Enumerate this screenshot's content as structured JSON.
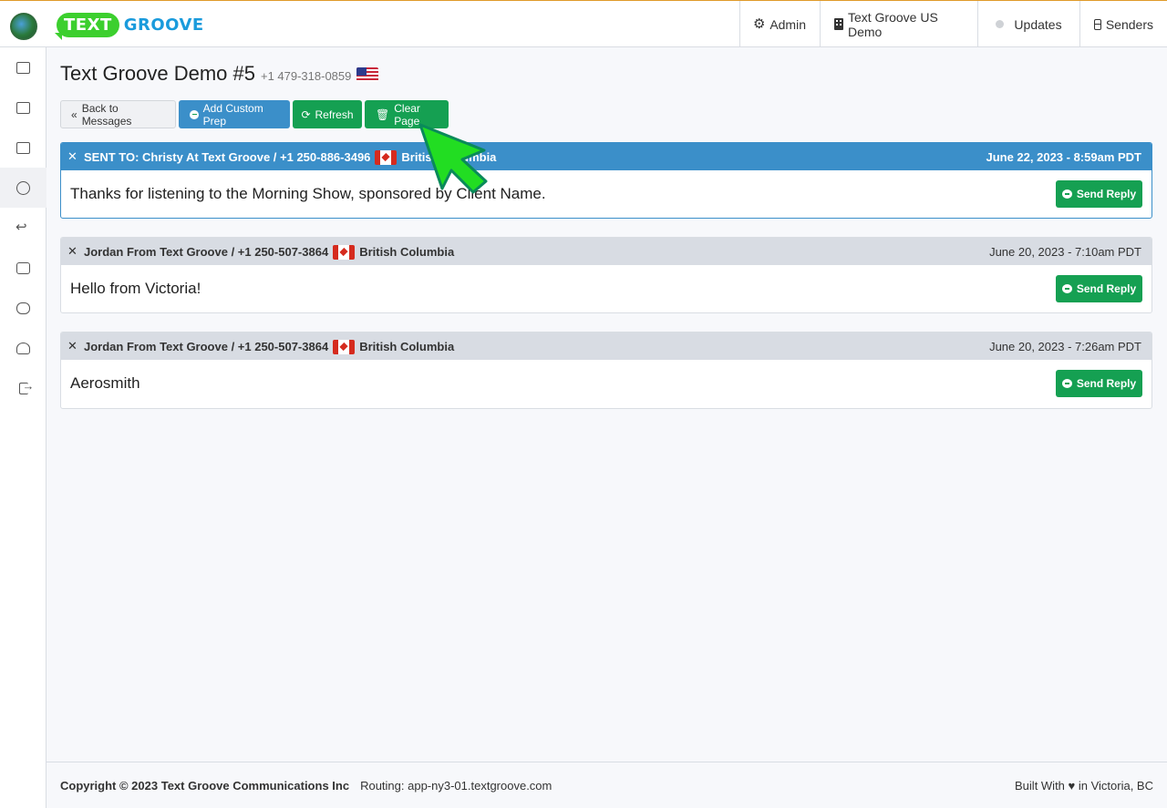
{
  "brand": {
    "badge": "TEXT",
    "name": "GROOVE"
  },
  "nav": {
    "admin": "Admin",
    "org": "Text Groove US Demo",
    "updates": "Updates",
    "senders": "Senders"
  },
  "page": {
    "title": "Text Groove Demo #5",
    "phone": "+1 479-318-0859"
  },
  "toolbar": {
    "back": "Back to Messages",
    "custom_prep": "Add Custom Prep",
    "refresh": "Refresh",
    "clear": "Clear Page"
  },
  "messages": [
    {
      "from": "SENT TO: Christy At Text Groove / +1 250-886-3496",
      "region": "British Columbia",
      "date": "June 22, 2023 - 8:59am PDT",
      "body": "Thanks for listening to the Morning Show, sponsored by Client Name.",
      "reply": "Send Reply"
    },
    {
      "from": "Jordan From Text Groove / +1 250-507-3864",
      "region": "British Columbia",
      "date": "June 20, 2023 - 7:10am PDT",
      "body": "Hello from Victoria!",
      "reply": "Send Reply"
    },
    {
      "from": "Jordan From Text Groove / +1 250-507-3864",
      "region": "British Columbia",
      "date": "June 20, 2023 - 7:26am PDT",
      "body": "Aerosmith",
      "reply": "Send Reply"
    }
  ],
  "footer": {
    "copyright": "Copyright © 2023 Text Groove Communications Inc",
    "routing": "Routing: app-ny3-01.textgroove.com",
    "built": "Built With ♥ in Victoria, BC"
  },
  "colors": {
    "accent_blue": "#3b8fc9",
    "accent_green": "#15a052",
    "brand_green": "#3ccf2e",
    "brand_blue": "#1a9bdc"
  },
  "icons": {
    "sidebar": [
      "inbox-icon",
      "columns-icon",
      "contacts-icon",
      "compass-icon",
      "reply-clock-icon",
      "message-icon",
      "chats-icon",
      "user-settings-icon",
      "logout-icon"
    ]
  }
}
